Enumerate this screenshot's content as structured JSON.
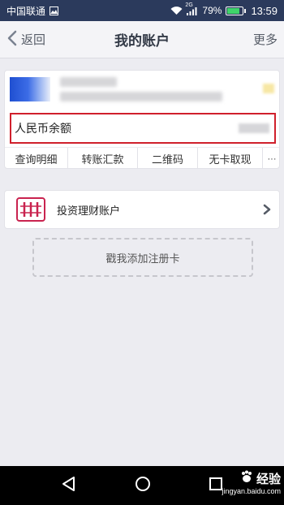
{
  "status_bar": {
    "carrier": "中国联通",
    "network": "2G",
    "battery": "79%",
    "battery_level": 0.79,
    "time": "13:59"
  },
  "nav": {
    "back_label": "返回",
    "title": "我的账户",
    "more_label": "更多"
  },
  "account_card": {
    "balance_label": "人民币余额",
    "actions": [
      "查询明细",
      "转账汇款",
      "二维码",
      "无卡取现",
      "···"
    ]
  },
  "investment": {
    "label": "投资理财账户"
  },
  "add_card": {
    "label": "戳我添加注册卡"
  },
  "watermark": {
    "brand": "经验",
    "url": "jingyan.baidu.com"
  },
  "colors": {
    "status_bar": "#2b3a5c",
    "highlight_border": "#d0202c",
    "invest_icon": "#c9234f"
  }
}
